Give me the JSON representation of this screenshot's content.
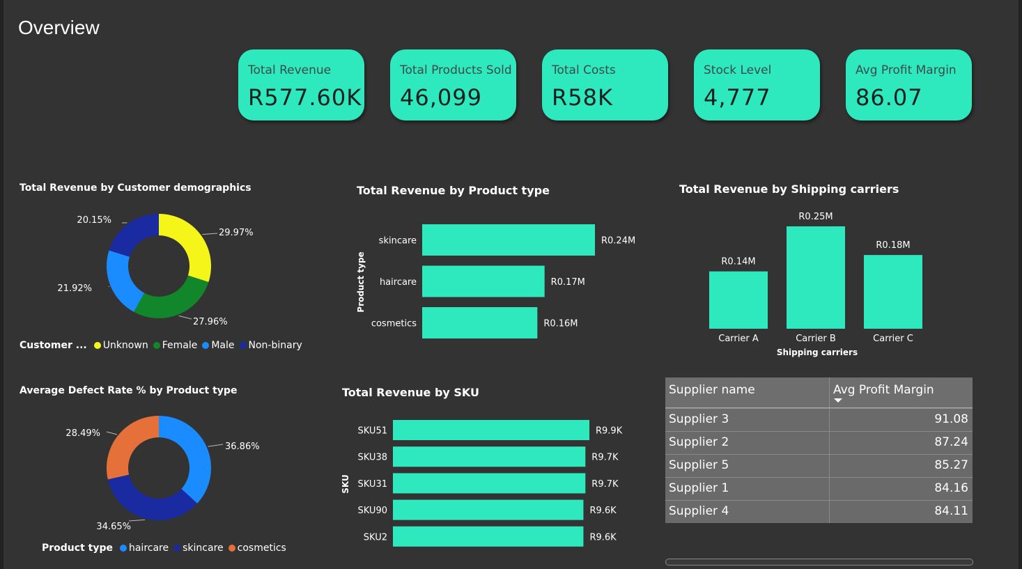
{
  "page": {
    "title": "Overview"
  },
  "kpis": [
    {
      "label": "Total Revenue",
      "value": "R577.60K"
    },
    {
      "label": "Total Products Sold",
      "value": "46,099"
    },
    {
      "label": "Total Costs",
      "value": "R58K"
    },
    {
      "label": "Stock Level",
      "value": "4,777"
    },
    {
      "label": "Avg Profit Margin",
      "value": "86.07"
    }
  ],
  "colors": {
    "accent": "#2ee9bd",
    "background": "#333333",
    "yellow": "#f5f51a",
    "green": "#12862b",
    "lightblue": "#1a8cff",
    "darkblue": "#1a2aa0",
    "orange": "#e6703a"
  },
  "chart_data": [
    {
      "type": "pie",
      "title": "Total Revenue by Customer demographics",
      "legend_title": "Customer ...",
      "categories": [
        "Unknown",
        "Female",
        "Male",
        "Non-binary"
      ],
      "values": [
        29.97,
        27.96,
        21.92,
        20.15
      ],
      "labels": [
        "29.97%",
        "27.96%",
        "21.92%",
        "20.15%"
      ],
      "colors": [
        "#f5f51a",
        "#12862b",
        "#1a8cff",
        "#1a2aa0"
      ],
      "legend_position": "bottom"
    },
    {
      "type": "bar",
      "orientation": "horizontal",
      "title": "Total Revenue by Product type",
      "ylabel": "Product type",
      "categories": [
        "skincare",
        "haircare",
        "cosmetics"
      ],
      "values": [
        0.24,
        0.17,
        0.16
      ],
      "labels": [
        "R0.24M",
        "R0.17M",
        "R0.16M"
      ]
    },
    {
      "type": "bar",
      "orientation": "vertical",
      "title": "Total Revenue by Shipping carriers",
      "xlabel": "Shipping carriers",
      "categories": [
        "Carrier A",
        "Carrier B",
        "Carrier C"
      ],
      "values": [
        0.14,
        0.25,
        0.18
      ],
      "labels": [
        "R0.14M",
        "R0.25M",
        "R0.18M"
      ]
    },
    {
      "type": "pie",
      "title": "Average Defect Rate % by Product type",
      "legend_title": "Product type",
      "categories": [
        "haircare",
        "skincare",
        "cosmetics"
      ],
      "values": [
        36.86,
        34.65,
        28.49
      ],
      "labels": [
        "36.86%",
        "34.65%",
        "28.49%"
      ],
      "colors": [
        "#1a8cff",
        "#1a2aa0",
        "#e6703a"
      ],
      "legend_position": "bottom"
    },
    {
      "type": "bar",
      "orientation": "horizontal",
      "title": "Total Revenue by SKU",
      "ylabel": "SKU",
      "categories": [
        "SKU51",
        "SKU38",
        "SKU31",
        "SKU90",
        "SKU2"
      ],
      "values": [
        9.9,
        9.7,
        9.7,
        9.6,
        9.6
      ],
      "labels": [
        "R9.9K",
        "R9.7K",
        "R9.7K",
        "R9.6K",
        "R9.6K"
      ]
    },
    {
      "type": "table",
      "columns": [
        "Supplier name",
        "Avg Profit Margin"
      ],
      "rows": [
        [
          "Supplier 3",
          "91.08"
        ],
        [
          "Supplier 2",
          "87.24"
        ],
        [
          "Supplier 5",
          "85.27"
        ],
        [
          "Supplier 1",
          "84.16"
        ],
        [
          "Supplier 4",
          "84.11"
        ]
      ],
      "sort": "Avg Profit Margin descending"
    }
  ]
}
